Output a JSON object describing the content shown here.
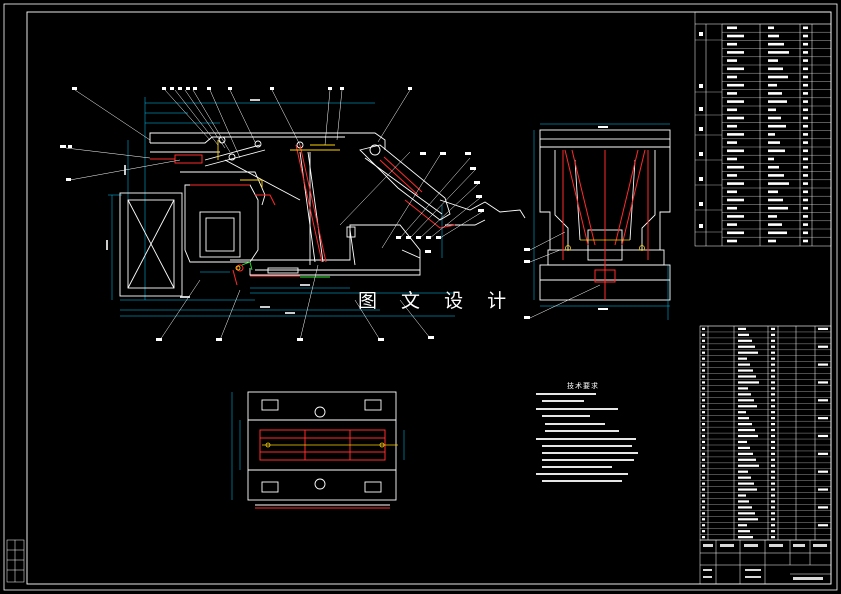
{
  "watermark": "图 文 设 计",
  "tech_requirements": {
    "title": "技术要求"
  },
  "colors": {
    "background": "#000000",
    "frame": "#ffffff",
    "red": "#ff2a2a",
    "cyan": "#00c8ff",
    "yellow": "#ffd200",
    "green": "#2ee82e"
  }
}
